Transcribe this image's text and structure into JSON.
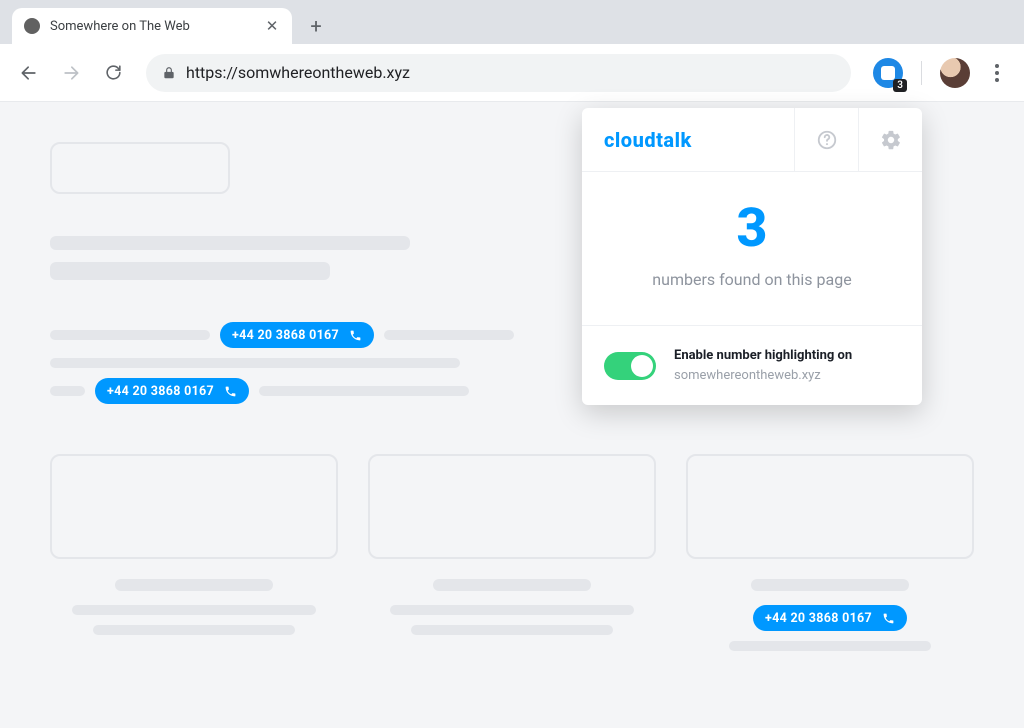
{
  "browser": {
    "tab_title": "Somewhere on The Web",
    "url": "https://somwhereontheweb.xyz",
    "extension_badge": "3"
  },
  "phone_numbers": {
    "n1": "+44 20 3868 0167",
    "n2": "+44 20 3868 0167",
    "n3": "+44 20 3868 0167"
  },
  "popup": {
    "brand": "cloudtalk",
    "count": "3",
    "subtitle": "numbers found on this page",
    "toggle_label": "Enable number highlighting on",
    "toggle_domain": "somewhereontheweb.xyz"
  }
}
